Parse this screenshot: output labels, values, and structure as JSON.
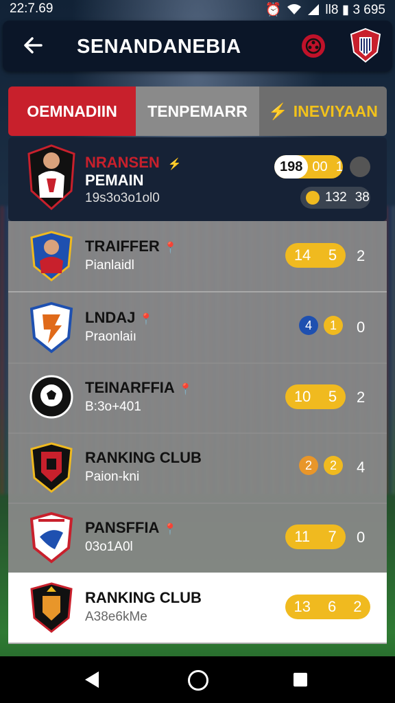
{
  "status_bar": {
    "time": "22:7.69",
    "right_text": "ll8 ▮ 3 695"
  },
  "app_bar": {
    "title": "SENANDANEBIA"
  },
  "tabs": [
    {
      "label": "OEMNADIIN"
    },
    {
      "label": "TENPEMARR"
    },
    {
      "label": "INEVIYAAN"
    }
  ],
  "featured": {
    "name": "NRANSEN",
    "title": "PEMAIN",
    "sub": "19s3o3o1ol0",
    "pill_left": "198",
    "pill_right_1": "00",
    "pill_right_2": "1",
    "stat_pill_text": "132",
    "stat_extra": "38"
  },
  "rows": [
    {
      "name": "TRAIFFER",
      "sub": "Pianlaidl",
      "pill": [
        "14",
        "5"
      ],
      "num": "2"
    },
    {
      "name": "LNDAJ",
      "sub": "Praonlaiı",
      "badge_blue": "4",
      "badge_yellow": "1",
      "num": "0"
    },
    {
      "name": "TEINARFFIA",
      "sub": "B:3o+401",
      "pill": [
        "10",
        "5"
      ],
      "num": "2"
    },
    {
      "name": "RANKING CLUB",
      "sub": "Paion-kni",
      "badge_orange": "2",
      "badge_yellow": "2",
      "num": "4"
    },
    {
      "name": "PANSFFIA",
      "sub": "03o1A0l",
      "pill": [
        "11",
        "7"
      ],
      "num": "0"
    },
    {
      "name": "RANKING CLUB",
      "sub": "A38e6kMe",
      "pill": [
        "13",
        "6",
        "2"
      ]
    }
  ],
  "colors": {
    "accent_red": "#c8202c",
    "gold": "#f0ba1f",
    "blue": "#1e50b0"
  }
}
